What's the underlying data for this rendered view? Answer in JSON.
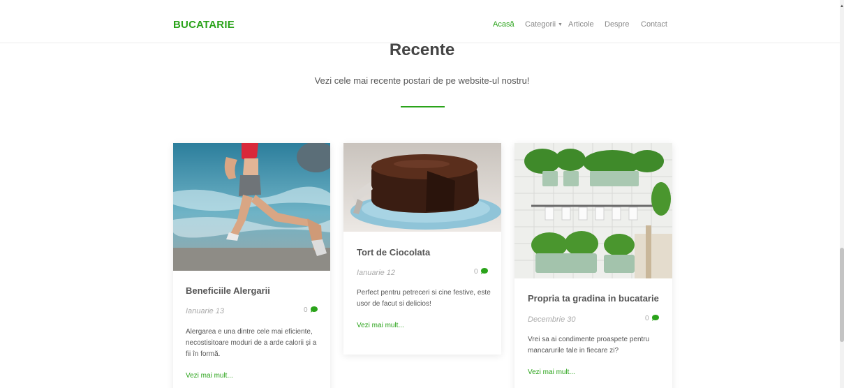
{
  "brand": "BUCATARIE",
  "nav": {
    "items": [
      "Acasă",
      "Categorii",
      "Articole",
      "Despre",
      "Contact"
    ],
    "active": "Acasă"
  },
  "section": {
    "title": "Recente",
    "subtitle": "Vezi cele mai recente postari de pe website-ul nostru!"
  },
  "posts": [
    {
      "title": "Beneficiile Alergarii",
      "date": "Ianuarie 13",
      "comments": "0",
      "excerpt": "Alergarea e una dintre cele mai eficiente, necostisitoare moduri de a arde calorii și a fii în formă.",
      "more": "Vezi mai mult..."
    },
    {
      "title": "Tort de Ciocolata",
      "date": "Ianuarie 12",
      "comments": "0",
      "excerpt": "Perfect pentru petreceri si cine festive, este usor de facut si delicios!",
      "more": "Vezi mai mult..."
    },
    {
      "title": "Propria ta gradina in bucatarie",
      "date": "Decembrie 30",
      "comments": "0",
      "excerpt": "Vrei sa ai condimente proaspete pentru mancarurile tale in fiecare zi?",
      "more": "Vezi mai mult..."
    }
  ],
  "colors": {
    "accent": "#2aa31a",
    "muted": "#aaaaaa"
  },
  "icons": {
    "comment": "comment-bubble-icon",
    "dropdown": "chevron-down-icon"
  }
}
